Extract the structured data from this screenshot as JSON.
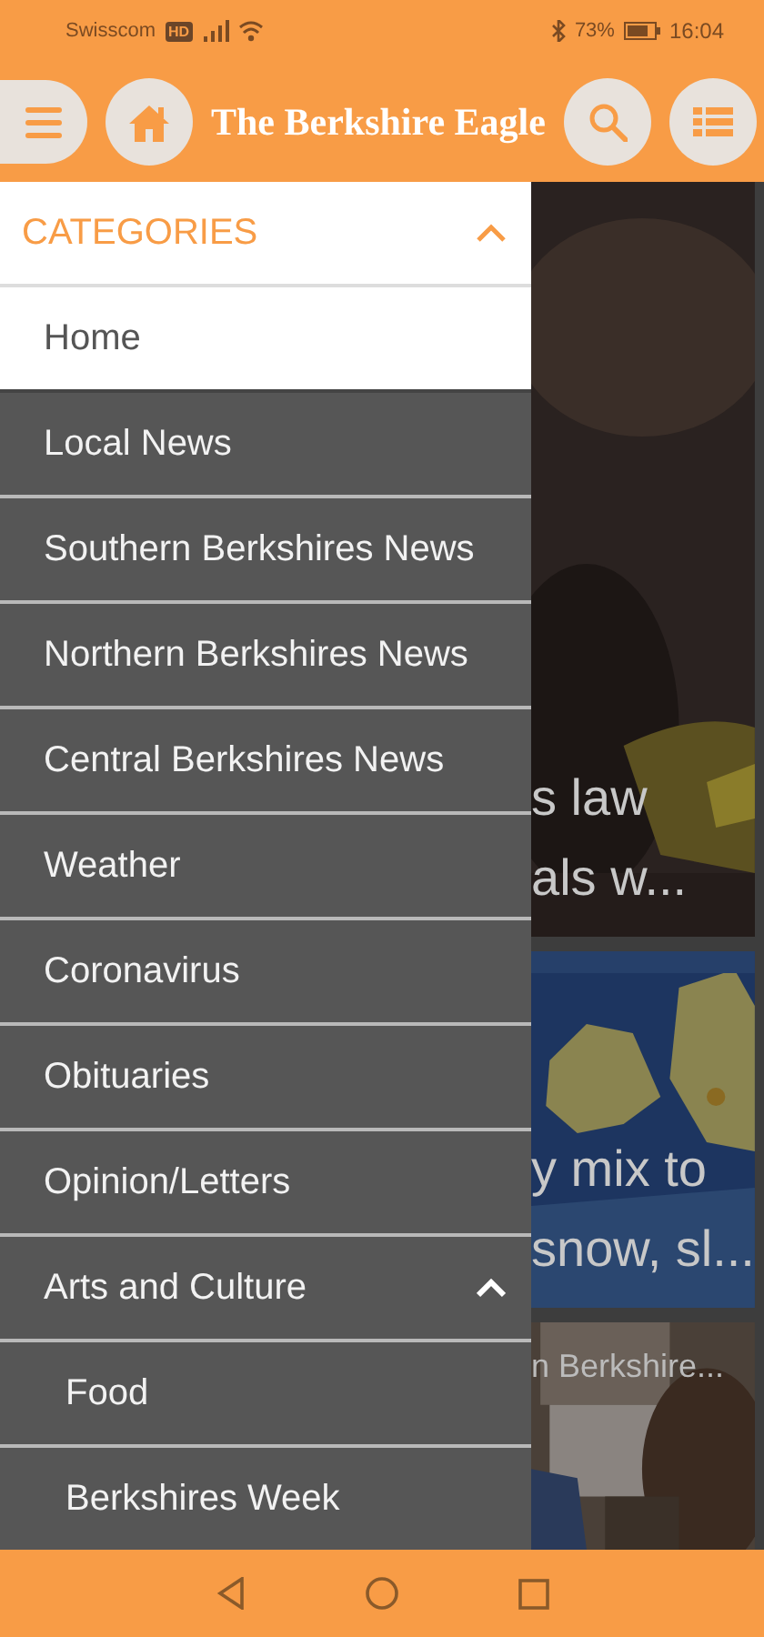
{
  "status_bar": {
    "carrier": "Swisscom",
    "carrier_badge": "HD",
    "battery": "73%",
    "time": "16:04"
  },
  "header": {
    "title": "The Berkshire Eagle"
  },
  "drawer": {
    "heading": "CATEGORIES",
    "expanded": true,
    "items": [
      {
        "label": "Home",
        "selected": true
      },
      {
        "label": "Local News",
        "selected": false
      },
      {
        "label": "Southern Berkshires News",
        "selected": false
      },
      {
        "label": "Northern Berkshires News",
        "selected": false
      },
      {
        "label": "Central Berkshires News",
        "selected": false
      },
      {
        "label": "Weather",
        "selected": false
      },
      {
        "label": "Coronavirus",
        "selected": false
      },
      {
        "label": "Obituaries",
        "selected": false
      },
      {
        "label": "Opinion/Letters",
        "selected": false
      },
      {
        "label": "Arts and Culture",
        "selected": false,
        "kind": "group",
        "expanded": true,
        "children": [
          {
            "label": "Food",
            "selected": false
          },
          {
            "label": "Berkshires Week",
            "selected": false
          }
        ]
      }
    ]
  },
  "stories": [
    {
      "kind": "dark",
      "lines": [
        "s law",
        "als w..."
      ]
    },
    {
      "kind": "map",
      "lines": [
        "y mix to",
        "snow, sl..."
      ]
    },
    {
      "kind": "people",
      "lines": [
        "n Berkshire..."
      ]
    }
  ]
}
